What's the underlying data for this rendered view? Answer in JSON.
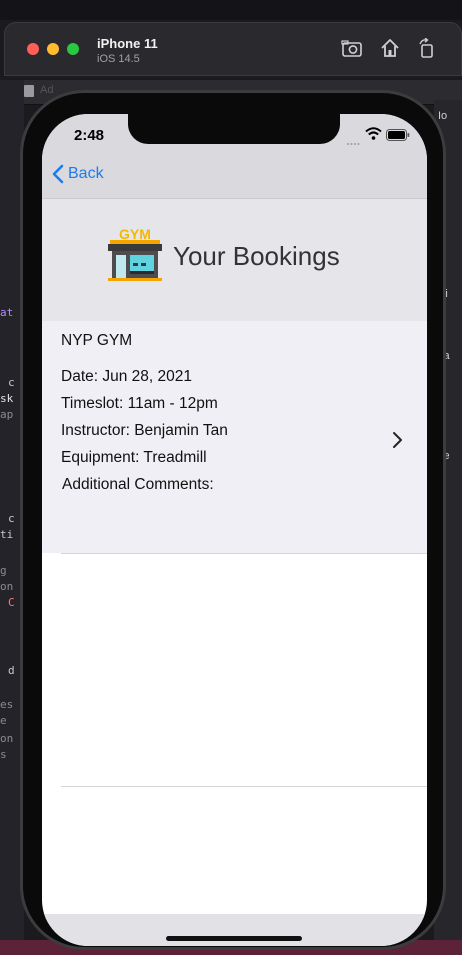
{
  "simulator": {
    "device": "iPhone 11",
    "os": "iOS 14.5"
  },
  "ide": {
    "left_fragments": [
      "at",
      "c",
      "sk",
      "ap",
      "c",
      "ti",
      "g",
      "on",
      "C",
      "d",
      "es",
      "e",
      "on",
      "s"
    ],
    "right_fragments": [
      "Io",
      "Pi",
      "Ta",
      "Te"
    ],
    "tab_text": "Ad"
  },
  "status_bar": {
    "time": "2:48"
  },
  "nav": {
    "back_label": "Back"
  },
  "header": {
    "title": "Your Bookings",
    "logo_text": "GYM"
  },
  "booking": {
    "gym": "NYP GYM",
    "date": "Date:  Jun 28, 2021",
    "timeslot": "Timeslot:  11am - 12pm",
    "instructor": "Instructor:  Benjamin Tan",
    "equipment": "Equipment:  Treadmill",
    "comments": "Additional Comments:"
  },
  "colors": {
    "accent": "#1a7cf0",
    "nav_bg": "#d9d9de",
    "cell_bg": "#f0eff5"
  }
}
